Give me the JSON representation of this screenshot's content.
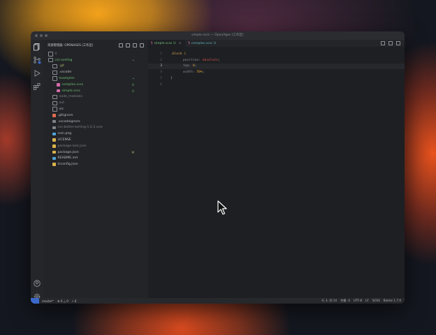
{
  "window": {
    "title": "simple.scss — OpenAges (工作区)"
  },
  "sidebar": {
    "header": "资源管理器: OPENAGES (工作区)",
    "tree": [
      {
        "label": "ll",
        "icon": "folder-icon",
        "indent": 0,
        "color": "dim",
        "status": ""
      },
      {
        "label": "css-sorting",
        "icon": "folder-open-icon",
        "indent": 0,
        "color": "green",
        "status": "•"
      },
      {
        "label": ".git",
        "icon": "folder-icon",
        "indent": 1,
        "color": "olive",
        "status": ""
      },
      {
        "label": ".vscode",
        "icon": "folder-icon",
        "indent": 1,
        "color": "normal",
        "status": ""
      },
      {
        "label": "examples",
        "icon": "folder-open-icon",
        "indent": 1,
        "color": "green",
        "status": "•"
      },
      {
        "label": "complex.scss",
        "icon": "scss-file-icon",
        "indent": 2,
        "color": "green",
        "status": "U"
      },
      {
        "label": "simple.scss",
        "icon": "scss-file-icon",
        "indent": 2,
        "color": "green",
        "status": "U"
      },
      {
        "label": "node_modules",
        "icon": "folder-icon",
        "indent": 1,
        "color": "dim",
        "status": ""
      },
      {
        "label": "out",
        "icon": "folder-icon",
        "indent": 1,
        "color": "dim",
        "status": ""
      },
      {
        "label": "src",
        "icon": "folder-icon",
        "indent": 1,
        "color": "normal",
        "status": ""
      },
      {
        "label": ".gitignore",
        "icon": "git-file-icon",
        "indent": 1,
        "color": "normal",
        "status": ""
      },
      {
        "label": ".vscodeignore",
        "icon": "file-icon",
        "indent": 1,
        "color": "normal",
        "status": ""
      },
      {
        "label": "css-better-sorting-1.0.2.vsix",
        "icon": "file-icon",
        "indent": 1,
        "color": "dim",
        "status": ""
      },
      {
        "label": "icon.png",
        "icon": "image-file-icon",
        "indent": 1,
        "color": "normal",
        "status": ""
      },
      {
        "label": "LICENSE",
        "icon": "license-file-icon",
        "indent": 1,
        "color": "normal",
        "status": ""
      },
      {
        "label": "package-lock.json",
        "icon": "json-file-icon",
        "indent": 1,
        "color": "dim",
        "status": ""
      },
      {
        "label": "package.json",
        "icon": "json-file-icon",
        "indent": 1,
        "color": "normal",
        "status": "M"
      },
      {
        "label": "README.md",
        "icon": "info-file-icon",
        "indent": 1,
        "color": "normal",
        "status": ""
      },
      {
        "label": "tsconfig.json",
        "icon": "json-file-icon",
        "indent": 1,
        "color": "normal",
        "status": ""
      }
    ]
  },
  "tabs": [
    {
      "label": "simple.scss",
      "badge": "U",
      "active": true
    },
    {
      "label": "complex.scss",
      "badge": "U",
      "active": false
    }
  ],
  "code": {
    "lines": [
      {
        "num": "1",
        "text": ".block {",
        "kind": "selector",
        "current": false
      },
      {
        "num": "2",
        "prop": "position: ",
        "value": "absolute",
        "end": ";",
        "kind": "decl-red",
        "current": false
      },
      {
        "num": "3",
        "prop": "top: ",
        "value": "0",
        "end": ";",
        "kind": "decl-num",
        "current": true
      },
      {
        "num": "4",
        "prop": "width: ",
        "value": "50%",
        "end": ";",
        "kind": "decl-num",
        "current": false
      },
      {
        "num": "5",
        "text": "}",
        "kind": "punct",
        "current": false
      },
      {
        "num": "6",
        "text": "",
        "kind": "empty",
        "current": false
      }
    ]
  },
  "statusbar": {
    "branch": "master*",
    "problems": "⊗ 0 △ 0",
    "ports": "⑂ 0",
    "position": "行 3, 列 14",
    "indent": "空格: 4",
    "encoding": "UTF-8",
    "eol": "LF",
    "language": "SCSS",
    "extension": "Biome 1.7.0"
  },
  "colors": {
    "accent": "#3b68c9",
    "green": "#6fbf73",
    "selector": "#d9a34c",
    "value_red": "#d0534f",
    "value_num": "#e0a23d"
  }
}
